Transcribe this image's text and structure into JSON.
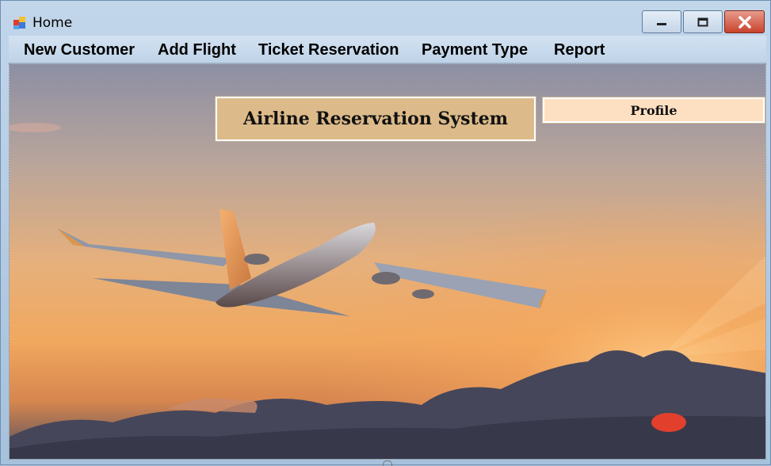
{
  "window": {
    "title": "Home",
    "title_icon": "windows-forms-app-icon",
    "controls": {
      "minimize": "minimize-icon",
      "maximize": "maximize-icon",
      "close": "close-icon"
    }
  },
  "menu": {
    "items": [
      "New Customer",
      "Add Flight",
      "Ticket Reservation",
      "Payment Type",
      "Report"
    ]
  },
  "content": {
    "heading": "Airline Reservation System",
    "profile_label": "Profile",
    "background_image": "airplane-sunset-photo"
  },
  "colors": {
    "heading_box": "#dcba8a",
    "profile_button": "#fde0c2",
    "close_button": "#c9432c"
  }
}
